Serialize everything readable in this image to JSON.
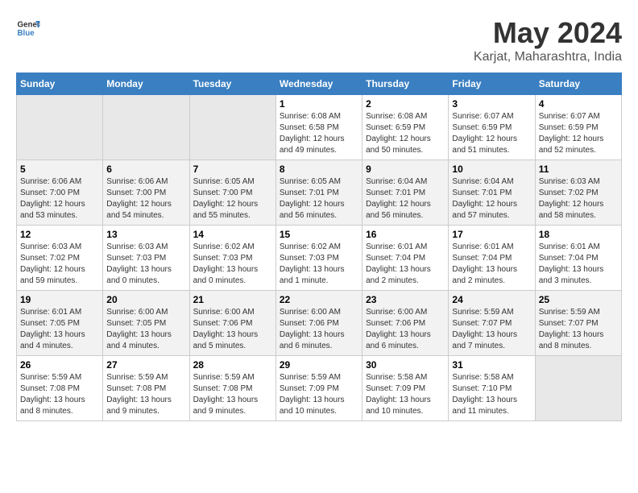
{
  "header": {
    "logo_line1": "General",
    "logo_line2": "Blue",
    "month": "May 2024",
    "location": "Karjat, Maharashtra, India"
  },
  "days_of_week": [
    "Sunday",
    "Monday",
    "Tuesday",
    "Wednesday",
    "Thursday",
    "Friday",
    "Saturday"
  ],
  "weeks": [
    [
      {
        "day": "",
        "info": ""
      },
      {
        "day": "",
        "info": ""
      },
      {
        "day": "",
        "info": ""
      },
      {
        "day": "1",
        "info": "Sunrise: 6:08 AM\nSunset: 6:58 PM\nDaylight: 12 hours\nand 49 minutes."
      },
      {
        "day": "2",
        "info": "Sunrise: 6:08 AM\nSunset: 6:59 PM\nDaylight: 12 hours\nand 50 minutes."
      },
      {
        "day": "3",
        "info": "Sunrise: 6:07 AM\nSunset: 6:59 PM\nDaylight: 12 hours\nand 51 minutes."
      },
      {
        "day": "4",
        "info": "Sunrise: 6:07 AM\nSunset: 6:59 PM\nDaylight: 12 hours\nand 52 minutes."
      }
    ],
    [
      {
        "day": "5",
        "info": "Sunrise: 6:06 AM\nSunset: 7:00 PM\nDaylight: 12 hours\nand 53 minutes."
      },
      {
        "day": "6",
        "info": "Sunrise: 6:06 AM\nSunset: 7:00 PM\nDaylight: 12 hours\nand 54 minutes."
      },
      {
        "day": "7",
        "info": "Sunrise: 6:05 AM\nSunset: 7:00 PM\nDaylight: 12 hours\nand 55 minutes."
      },
      {
        "day": "8",
        "info": "Sunrise: 6:05 AM\nSunset: 7:01 PM\nDaylight: 12 hours\nand 56 minutes."
      },
      {
        "day": "9",
        "info": "Sunrise: 6:04 AM\nSunset: 7:01 PM\nDaylight: 12 hours\nand 56 minutes."
      },
      {
        "day": "10",
        "info": "Sunrise: 6:04 AM\nSunset: 7:01 PM\nDaylight: 12 hours\nand 57 minutes."
      },
      {
        "day": "11",
        "info": "Sunrise: 6:03 AM\nSunset: 7:02 PM\nDaylight: 12 hours\nand 58 minutes."
      }
    ],
    [
      {
        "day": "12",
        "info": "Sunrise: 6:03 AM\nSunset: 7:02 PM\nDaylight: 12 hours\nand 59 minutes."
      },
      {
        "day": "13",
        "info": "Sunrise: 6:03 AM\nSunset: 7:03 PM\nDaylight: 13 hours\nand 0 minutes."
      },
      {
        "day": "14",
        "info": "Sunrise: 6:02 AM\nSunset: 7:03 PM\nDaylight: 13 hours\nand 0 minutes."
      },
      {
        "day": "15",
        "info": "Sunrise: 6:02 AM\nSunset: 7:03 PM\nDaylight: 13 hours\nand 1 minute."
      },
      {
        "day": "16",
        "info": "Sunrise: 6:01 AM\nSunset: 7:04 PM\nDaylight: 13 hours\nand 2 minutes."
      },
      {
        "day": "17",
        "info": "Sunrise: 6:01 AM\nSunset: 7:04 PM\nDaylight: 13 hours\nand 2 minutes."
      },
      {
        "day": "18",
        "info": "Sunrise: 6:01 AM\nSunset: 7:04 PM\nDaylight: 13 hours\nand 3 minutes."
      }
    ],
    [
      {
        "day": "19",
        "info": "Sunrise: 6:01 AM\nSunset: 7:05 PM\nDaylight: 13 hours\nand 4 minutes."
      },
      {
        "day": "20",
        "info": "Sunrise: 6:00 AM\nSunset: 7:05 PM\nDaylight: 13 hours\nand 4 minutes."
      },
      {
        "day": "21",
        "info": "Sunrise: 6:00 AM\nSunset: 7:06 PM\nDaylight: 13 hours\nand 5 minutes."
      },
      {
        "day": "22",
        "info": "Sunrise: 6:00 AM\nSunset: 7:06 PM\nDaylight: 13 hours\nand 6 minutes."
      },
      {
        "day": "23",
        "info": "Sunrise: 6:00 AM\nSunset: 7:06 PM\nDaylight: 13 hours\nand 6 minutes."
      },
      {
        "day": "24",
        "info": "Sunrise: 5:59 AM\nSunset: 7:07 PM\nDaylight: 13 hours\nand 7 minutes."
      },
      {
        "day": "25",
        "info": "Sunrise: 5:59 AM\nSunset: 7:07 PM\nDaylight: 13 hours\nand 8 minutes."
      }
    ],
    [
      {
        "day": "26",
        "info": "Sunrise: 5:59 AM\nSunset: 7:08 PM\nDaylight: 13 hours\nand 8 minutes."
      },
      {
        "day": "27",
        "info": "Sunrise: 5:59 AM\nSunset: 7:08 PM\nDaylight: 13 hours\nand 9 minutes."
      },
      {
        "day": "28",
        "info": "Sunrise: 5:59 AM\nSunset: 7:08 PM\nDaylight: 13 hours\nand 9 minutes."
      },
      {
        "day": "29",
        "info": "Sunrise: 5:59 AM\nSunset: 7:09 PM\nDaylight: 13 hours\nand 10 minutes."
      },
      {
        "day": "30",
        "info": "Sunrise: 5:58 AM\nSunset: 7:09 PM\nDaylight: 13 hours\nand 10 minutes."
      },
      {
        "day": "31",
        "info": "Sunrise: 5:58 AM\nSunset: 7:10 PM\nDaylight: 13 hours\nand 11 minutes."
      },
      {
        "day": "",
        "info": ""
      }
    ]
  ]
}
